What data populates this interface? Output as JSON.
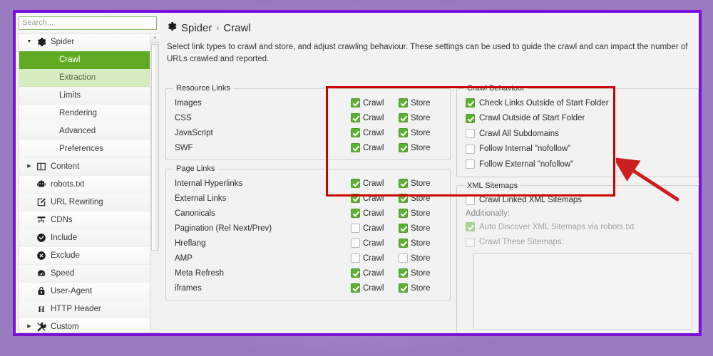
{
  "window": {
    "accent_purple": "#7a10d8",
    "accent_green": "#5faa22",
    "annotation_red": "#cc0000"
  },
  "sidebar": {
    "search": {
      "placeholder": "Search...",
      "value": ""
    },
    "scroll_up_icon": "caret-up-icon",
    "items": [
      {
        "label": "Spider",
        "icon": "gear-icon",
        "twisty": "expanded",
        "state": "normal",
        "child": false
      },
      {
        "label": "Crawl",
        "icon": "none",
        "twisty": "none",
        "state": "selected",
        "child": true
      },
      {
        "label": "Extraction",
        "icon": "none",
        "twisty": "none",
        "state": "hovered",
        "child": true
      },
      {
        "label": "Limits",
        "icon": "none",
        "twisty": "none",
        "state": "normal",
        "child": true
      },
      {
        "label": "Rendering",
        "icon": "none",
        "twisty": "none",
        "state": "normal",
        "child": true
      },
      {
        "label": "Advanced",
        "icon": "none",
        "twisty": "none",
        "state": "normal",
        "child": true
      },
      {
        "label": "Preferences",
        "icon": "none",
        "twisty": "none",
        "state": "normal",
        "child": true
      },
      {
        "label": "Content",
        "icon": "columns-icon",
        "twisty": "collapsed",
        "state": "normal",
        "child": false
      },
      {
        "label": "robots.txt",
        "icon": "robot-icon",
        "twisty": "none",
        "state": "normal",
        "child": false
      },
      {
        "label": "URL Rewriting",
        "icon": "pencil-box-icon",
        "twisty": "none",
        "state": "normal",
        "child": false
      },
      {
        "label": "CDNs",
        "icon": "branch-icon",
        "twisty": "none",
        "state": "normal",
        "child": false
      },
      {
        "label": "Include",
        "icon": "check-circle-icon",
        "twisty": "none",
        "state": "normal",
        "child": false
      },
      {
        "label": "Exclude",
        "icon": "x-circle-icon",
        "twisty": "none",
        "state": "normal",
        "child": false
      },
      {
        "label": "Speed",
        "icon": "gauge-icon",
        "twisty": "none",
        "state": "normal",
        "child": false
      },
      {
        "label": "User-Agent",
        "icon": "lock-icon",
        "twisty": "none",
        "state": "normal",
        "child": false
      },
      {
        "label": "HTTP Header",
        "icon": "letter-h-icon",
        "twisty": "none",
        "state": "normal",
        "child": false
      },
      {
        "label": "Custom",
        "icon": "tools-icon",
        "twisty": "collapsed",
        "state": "normal",
        "child": false
      }
    ]
  },
  "header": {
    "icon": "gear-icon",
    "crumb_root": "Spider",
    "crumb_sep": "›",
    "crumb_current": "Crawl",
    "description": "Select link types to crawl and store, and adjust crawling behaviour. These settings can be used to guide the crawl and can impact the number of URLs crawled and reported."
  },
  "resource_links": {
    "legend": "Resource Links",
    "crawl_label": "Crawl",
    "store_label": "Store",
    "rows": [
      {
        "label": "Images",
        "crawl": true,
        "store": true
      },
      {
        "label": "CSS",
        "crawl": true,
        "store": true
      },
      {
        "label": "JavaScript",
        "crawl": true,
        "store": true
      },
      {
        "label": "SWF",
        "crawl": true,
        "store": true
      }
    ]
  },
  "page_links": {
    "legend": "Page Links",
    "crawl_label": "Crawl",
    "store_label": "Store",
    "rows": [
      {
        "label": "Internal Hyperlinks",
        "crawl": true,
        "store": true
      },
      {
        "label": "External Links",
        "crawl": true,
        "store": true
      },
      {
        "label": "Canonicals",
        "crawl": true,
        "store": true
      },
      {
        "label": "Pagination (Rel Next/Prev)",
        "crawl": false,
        "store": true
      },
      {
        "label": "Hreflang",
        "crawl": false,
        "store": true
      },
      {
        "label": "AMP",
        "crawl": false,
        "store": false
      },
      {
        "label": "Meta Refresh",
        "crawl": true,
        "store": true
      },
      {
        "label": "iframes",
        "crawl": true,
        "store": true
      }
    ]
  },
  "crawl_behaviour": {
    "legend": "Crawl Behaviour",
    "rows": [
      {
        "label": "Check Links Outside of Start Folder",
        "checked": true,
        "disabled": false
      },
      {
        "label": "Crawl Outside of Start Folder",
        "checked": true,
        "disabled": false
      },
      {
        "label": "Crawl All Subdomains",
        "checked": false,
        "disabled": false
      },
      {
        "label": "Follow Internal \"nofollow\"",
        "checked": false,
        "disabled": false
      },
      {
        "label": "Follow External \"nofollow\"",
        "checked": false,
        "disabled": false
      }
    ]
  },
  "xml_sitemaps": {
    "legend": "XML Sitemaps",
    "crawl_linked": {
      "label": "Crawl Linked XML Sitemaps",
      "checked": false,
      "disabled": false
    },
    "additionally_label": "Additionally:",
    "auto_discover": {
      "label": "Auto Discover XML Sitemaps via robots.txt",
      "checked": true,
      "disabled": true
    },
    "crawl_these": {
      "label": "Crawl These Sitemaps:",
      "checked": false,
      "disabled": true
    },
    "textarea_value": ""
  },
  "annotations": {
    "rect_target": "Resource Links",
    "arrow_target": "Follow Internal \"nofollow\""
  }
}
